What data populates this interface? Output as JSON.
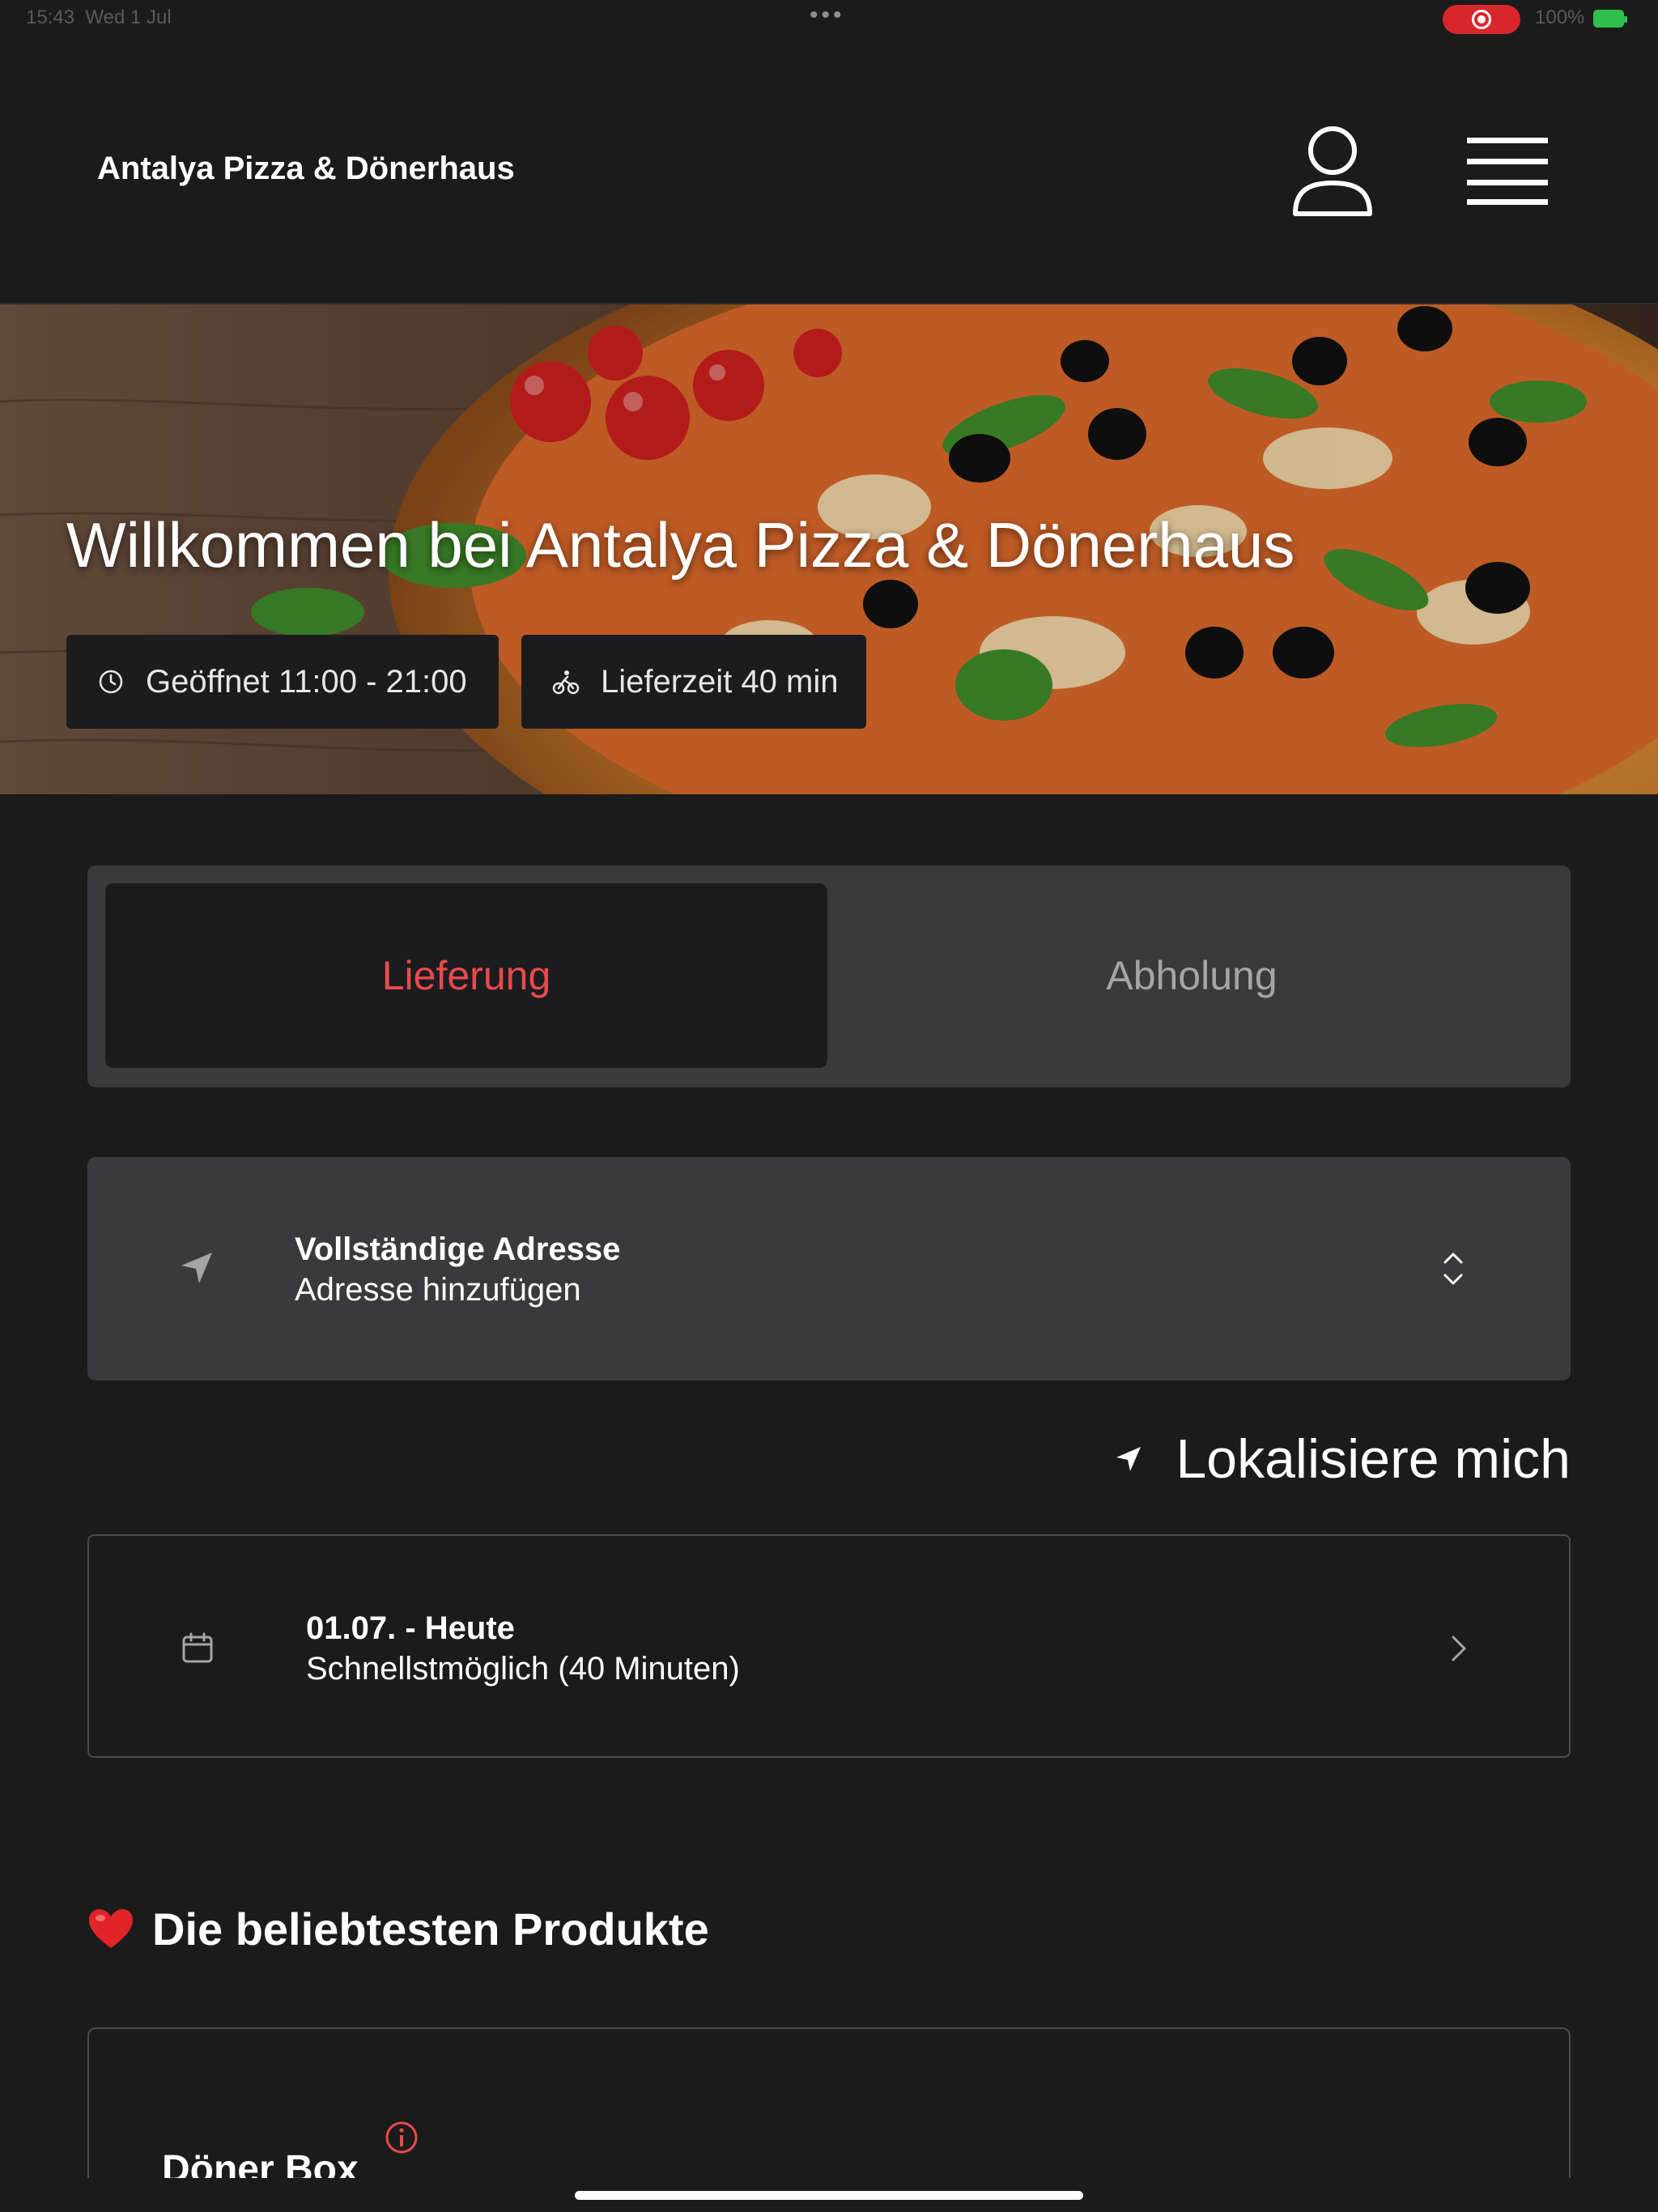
{
  "status_bar": {
    "time": "15:43",
    "date": "Wed 1 Jul",
    "dots": "•••",
    "battery": "100%",
    "battery_color": "#2fc04b",
    "recording_color": "#d9262b"
  },
  "header": {
    "brand": "Antalya Pizza & Dönerhaus",
    "icons": [
      "user-icon",
      "hamburger-menu-icon"
    ]
  },
  "hero": {
    "title": "Willkommen bei Antalya Pizza & Dönerhaus",
    "opening_hours": "Geöffnet 11:00 - 21:00",
    "delivery_time": "Lieferzeit 40 min"
  },
  "order_mode": {
    "delivery": "Lieferung",
    "pickup": "Abholung",
    "selected": "delivery",
    "accent_color": "#e94a4d"
  },
  "address": {
    "title": "Vollständige Adresse",
    "subtitle": "Adresse hinzufügen"
  },
  "locate": {
    "label": "Lokalisiere mich"
  },
  "schedule": {
    "title": "01.07. - Heute",
    "subtitle": "Schnellstmöglich (40 Minuten)"
  },
  "popular": {
    "title": "Die beliebtesten Produkte",
    "products": [
      {
        "name": "Döner Box"
      }
    ]
  }
}
